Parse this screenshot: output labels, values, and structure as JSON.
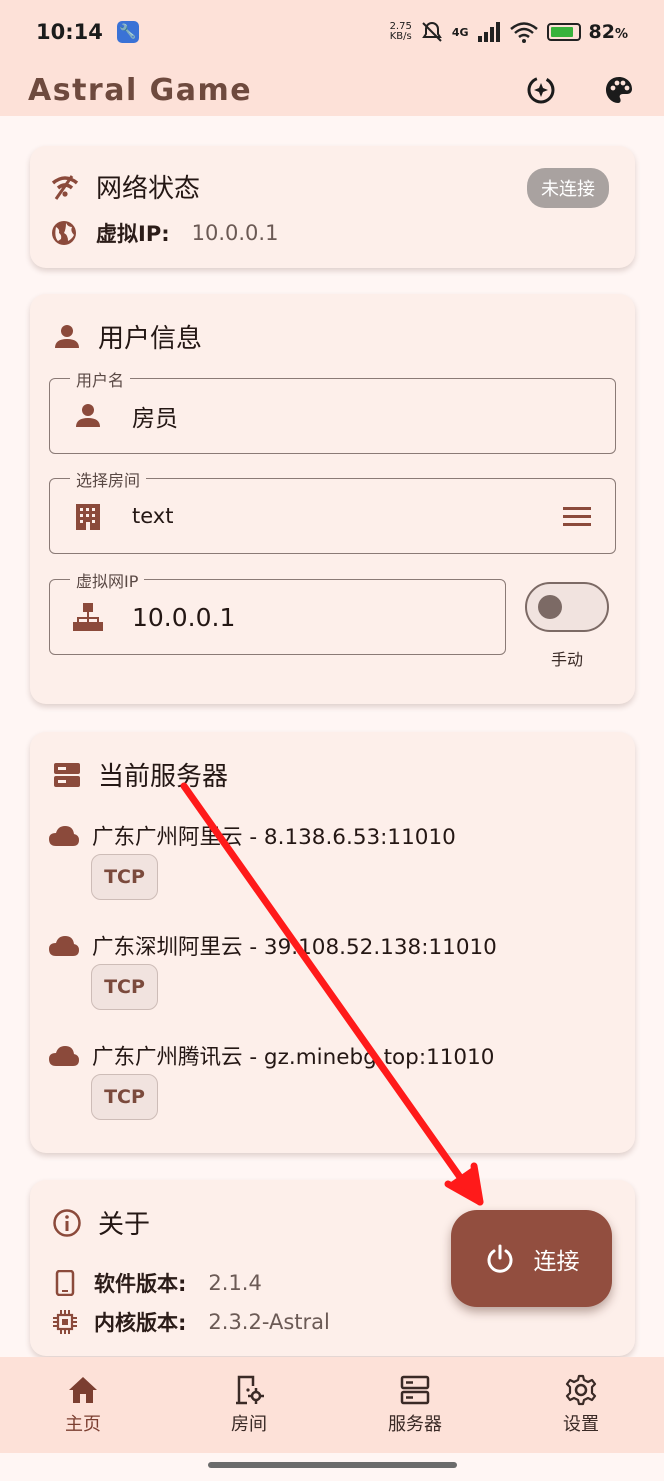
{
  "status_bar": {
    "time": "10:14",
    "net_speed_value": "2.75",
    "net_speed_unit": "KB/s",
    "network": "4G",
    "battery": "82",
    "battery_unit": "%"
  },
  "app": {
    "title": "Astral Game"
  },
  "network_card": {
    "title": "网络状态",
    "status_chip": "未连接",
    "ip_label": "虚拟IP:",
    "ip_value": "10.0.0.1"
  },
  "user_card": {
    "title": "用户信息",
    "username_label": "用户名",
    "username_value": "房员",
    "room_label": "选择房间",
    "room_value": "text",
    "vip_label": "虚拟网IP",
    "vip_value": "10.0.0.1",
    "switch_label": "手动",
    "switch_on": false
  },
  "server_card": {
    "title": "当前服务器",
    "servers": [
      {
        "name": "广东广州阿里云 - 8.138.6.53:11010",
        "protocol": "TCP"
      },
      {
        "name": "广东深圳阿里云 - 39.108.52.138:11010",
        "protocol": "TCP"
      },
      {
        "name": "广东广州腾讯云 - gz.minebg.top:11010",
        "protocol": "TCP"
      }
    ]
  },
  "about_card": {
    "title": "关于",
    "software_label": "软件版本:",
    "software_value": "2.1.4",
    "kernel_label": "内核版本:",
    "kernel_value": "2.3.2-Astral"
  },
  "fab": {
    "label": "连接"
  },
  "nav": [
    {
      "label": "主页",
      "icon": "home-icon",
      "active": true
    },
    {
      "label": "房间",
      "icon": "room-settings-icon",
      "active": false
    },
    {
      "label": "服务器",
      "icon": "server-icon",
      "active": false
    },
    {
      "label": "设置",
      "icon": "gear-icon",
      "active": false
    }
  ],
  "colors": {
    "accent": "#924e3f",
    "app_bar": "#fde1d8",
    "card": "#fdefea",
    "arrow": "#ff1a1a"
  }
}
